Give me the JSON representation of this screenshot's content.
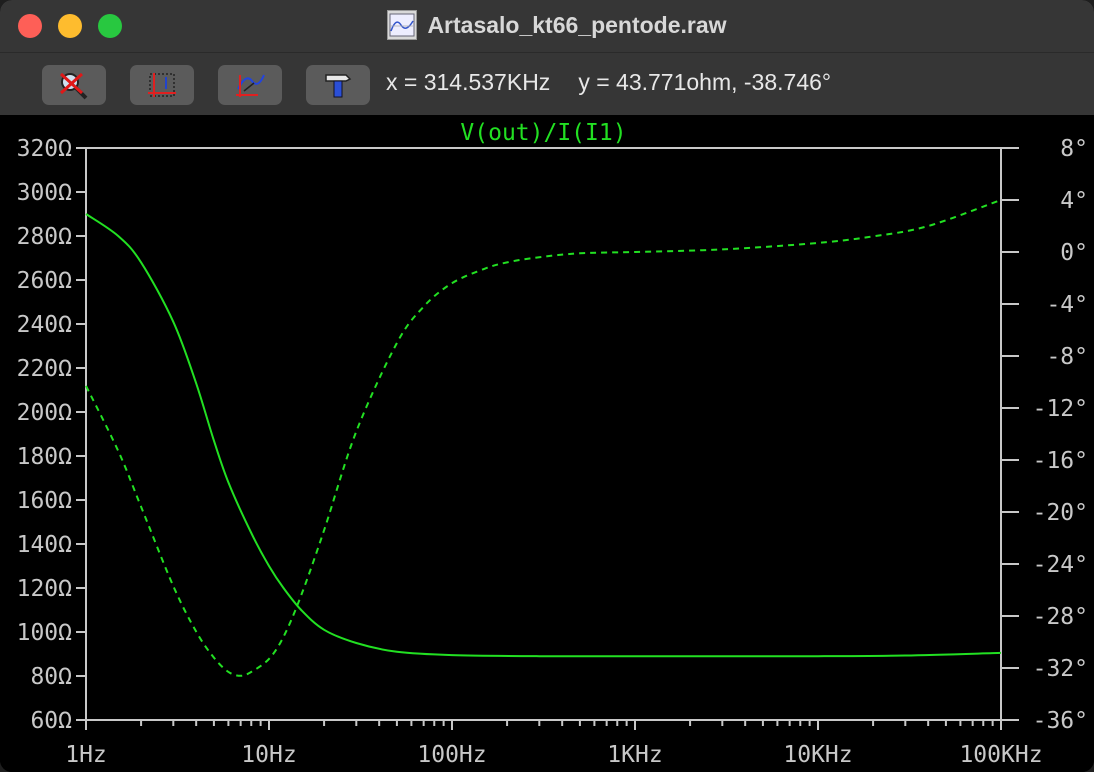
{
  "window": {
    "title": "Artasalo_kt66_pentode.raw"
  },
  "toolbar": {
    "readout_x": "x = 314.537KHz",
    "readout_y": "y = 43.771ohm, -38.746°",
    "buttons": [
      "zoom-cancel-icon",
      "autorange-icon",
      "pan-icon",
      "hammer-icon"
    ]
  },
  "colors": {
    "trace": "#22e022",
    "axis": "#c8c8c8",
    "background": "#000000"
  },
  "chart_data": {
    "type": "line",
    "title": "V(out)/I(I1)",
    "x_scale": "log",
    "xlim": [
      1,
      100000
    ],
    "x_ticks": [
      {
        "value": 1,
        "label": "1Hz"
      },
      {
        "value": 10,
        "label": "10Hz"
      },
      {
        "value": 100,
        "label": "100Hz"
      },
      {
        "value": 1000,
        "label": "1KHz"
      },
      {
        "value": 10000,
        "label": "10KHz"
      },
      {
        "value": 100000,
        "label": "100KHz"
      }
    ],
    "y_left": {
      "ylim": [
        60,
        320
      ],
      "ticks": [
        {
          "value": 320,
          "label": "320Ω"
        },
        {
          "value": 300,
          "label": "300Ω"
        },
        {
          "value": 280,
          "label": "280Ω"
        },
        {
          "value": 260,
          "label": "260Ω"
        },
        {
          "value": 240,
          "label": "240Ω"
        },
        {
          "value": 220,
          "label": "220Ω"
        },
        {
          "value": 200,
          "label": "200Ω"
        },
        {
          "value": 180,
          "label": "180Ω"
        },
        {
          "value": 160,
          "label": "160Ω"
        },
        {
          "value": 140,
          "label": "140Ω"
        },
        {
          "value": 120,
          "label": "120Ω"
        },
        {
          "value": 100,
          "label": "100Ω"
        },
        {
          "value": 80,
          "label": "80Ω"
        },
        {
          "value": 60,
          "label": "60Ω"
        }
      ]
    },
    "y_right": {
      "ylim": [
        -36,
        8
      ],
      "ticks": [
        {
          "value": 8,
          "label": "8°"
        },
        {
          "value": 4,
          "label": "4°"
        },
        {
          "value": 0,
          "label": "0°"
        },
        {
          "value": -4,
          "label": "-4°"
        },
        {
          "value": -8,
          "label": "-8°"
        },
        {
          "value": -12,
          "label": "-12°"
        },
        {
          "value": -16,
          "label": "-16°"
        },
        {
          "value": -20,
          "label": "-20°"
        },
        {
          "value": -24,
          "label": "-24°"
        },
        {
          "value": -28,
          "label": "-28°"
        },
        {
          "value": -32,
          "label": "-32°"
        },
        {
          "value": -36,
          "label": "-36°"
        }
      ]
    },
    "series": [
      {
        "kind": "magnitude",
        "axis": "left",
        "style": "solid",
        "x": [
          1,
          1.5,
          2,
          3,
          4,
          5,
          6,
          8,
          10,
          12,
          15,
          20,
          30,
          50,
          100,
          300,
          1000,
          10000,
          30000,
          100000
        ],
        "y": [
          290,
          280,
          268,
          241,
          213,
          187,
          168,
          145,
          130,
          120,
          110,
          101,
          95,
          91,
          89.5,
          89,
          89,
          89,
          89.3,
          90.5
        ]
      },
      {
        "kind": "phase",
        "axis": "right",
        "style": "dashed",
        "x": [
          1,
          1.5,
          2,
          3,
          4,
          5,
          6,
          7,
          8,
          10,
          12,
          15,
          20,
          30,
          50,
          70,
          100,
          150,
          200,
          300,
          500,
          1000,
          3000,
          10000,
          20000,
          40000,
          100000
        ],
        "y": [
          -10.3,
          -15.3,
          -19.6,
          -25.7,
          -29.2,
          -31.2,
          -32.3,
          -32.6,
          -32.3,
          -31.3,
          -29.6,
          -26.4,
          -21.4,
          -13.8,
          -7,
          -4.2,
          -2.4,
          -1.3,
          -0.8,
          -0.4,
          -0.1,
          0,
          0.2,
          0.7,
          1.2,
          2,
          4
        ]
      }
    ]
  }
}
